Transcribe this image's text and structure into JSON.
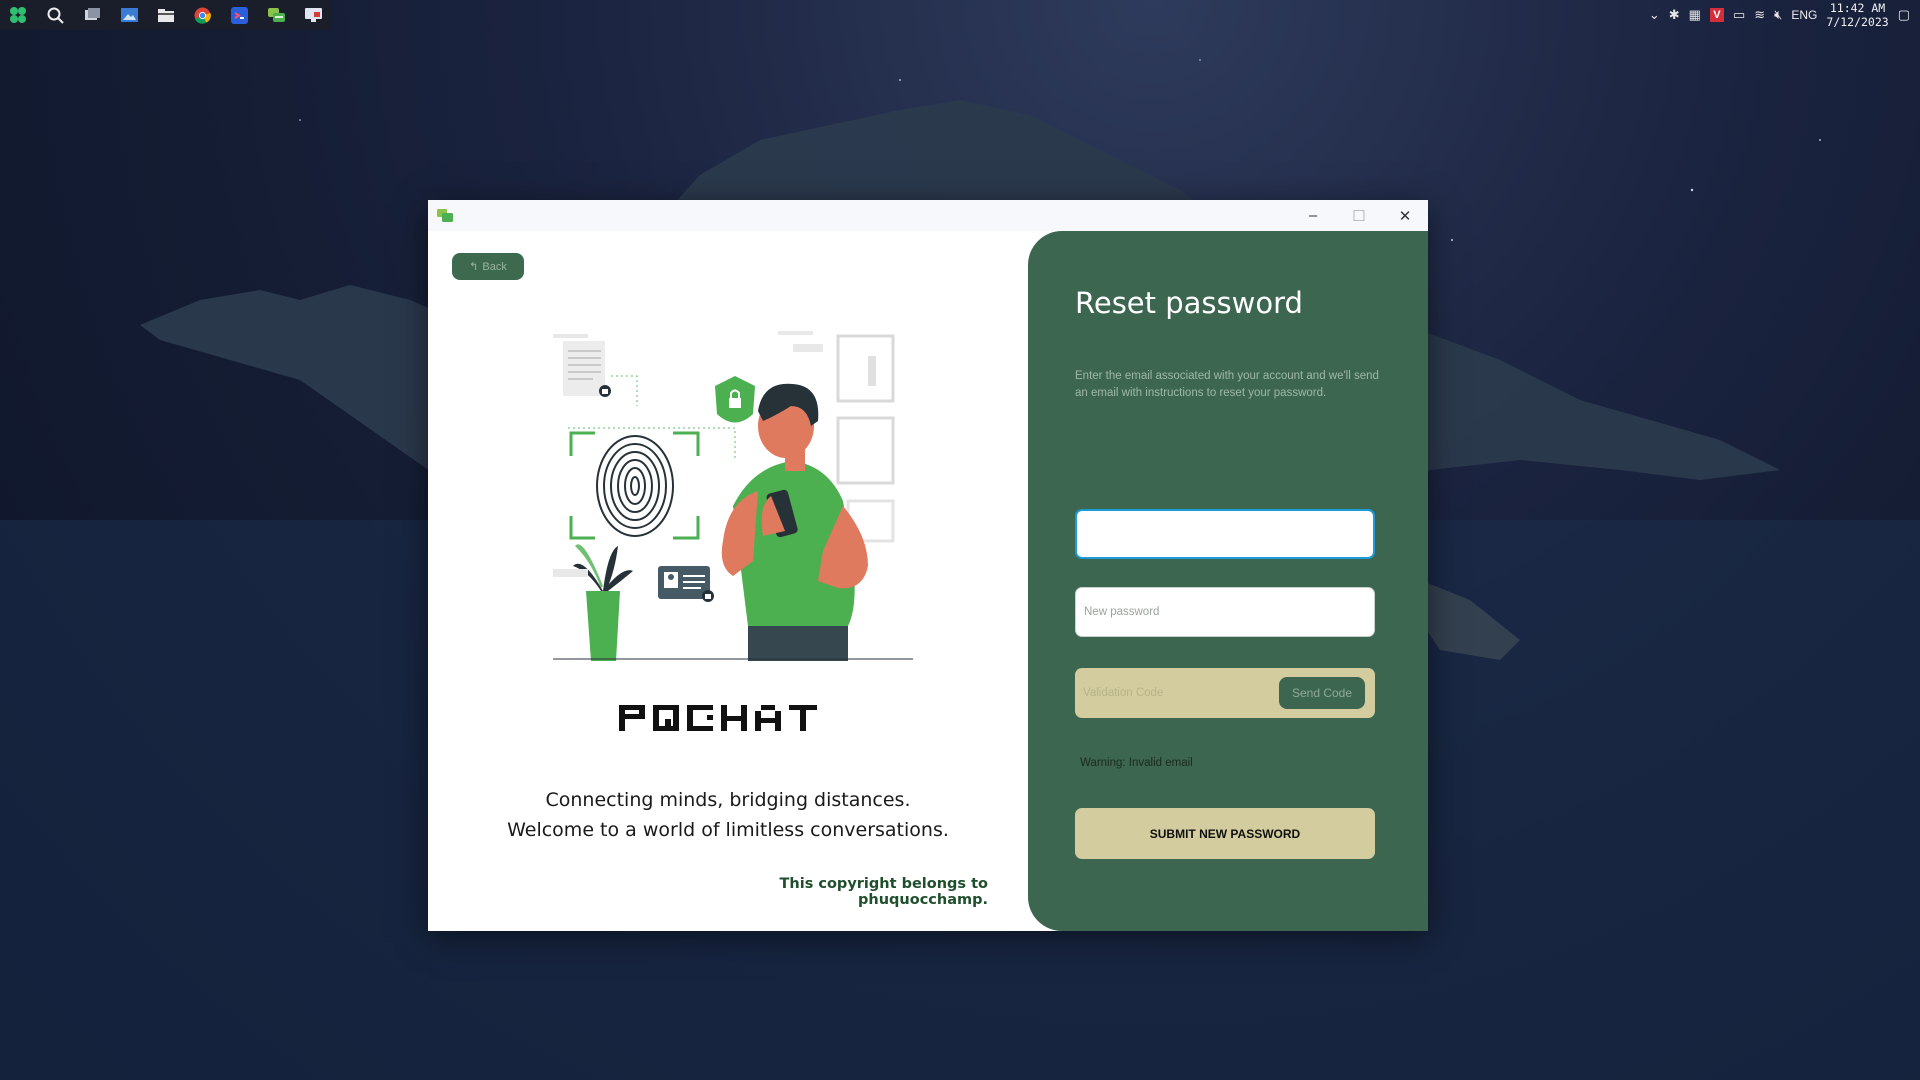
{
  "taskbar": {
    "icons": [
      "start-icon",
      "search-icon",
      "task-view-icon",
      "photos-icon",
      "file-explorer-icon",
      "chrome-icon",
      "code-editor-icon",
      "chat-app-icon",
      "remote-desktop-icon"
    ]
  },
  "tray": {
    "language": "ENG",
    "time": "11:42 AM",
    "date": "7/12/2023"
  },
  "window": {
    "controls": {
      "minimize": "–",
      "maximize": "☐",
      "close": "✕"
    }
  },
  "left": {
    "back_label": "Back",
    "logo_text": "PQCHAT",
    "tagline": "Connecting minds, bridging distances. Welcome to a world of limitless conversations.",
    "copyright": "This copyright belongs to phuquocchamp."
  },
  "right": {
    "title": "Reset password",
    "description": "Enter the email associated with your account and we'll send an email with instructions to reset your password.",
    "email_value": "",
    "password_placeholder": "New password",
    "code_placeholder": "Validation Code",
    "send_code_label": "Send Code",
    "warning": "Warning: Invalid email",
    "submit_label": "SUBMIT NEW PASSWORD"
  },
  "colors": {
    "panel_green": "#3d6650",
    "accent_sand": "#d2cc9e",
    "focus_blue": "#1e9ad6",
    "copyright_green": "#1f4f2c"
  }
}
